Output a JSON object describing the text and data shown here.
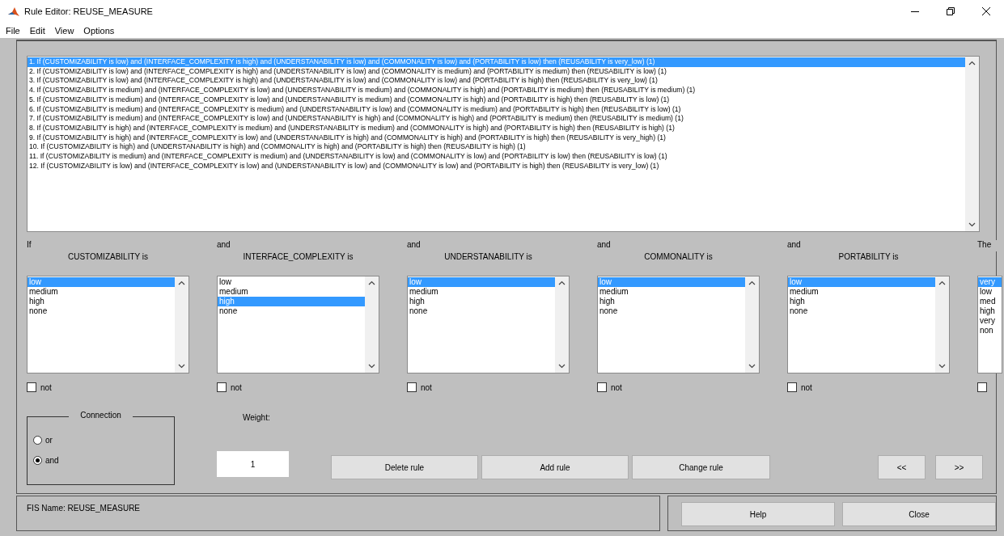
{
  "window": {
    "title": "Rule Editor: REUSE_MEASURE"
  },
  "menu": [
    "File",
    "Edit",
    "View",
    "Options"
  ],
  "rules": [
    {
      "text": "1. If (CUSTOMIZABILITY is low) and (INTERFACE_COMPLEXITY is high) and (UNDERSTANABILITY is low) and (COMMONALITY is low) and (PORTABILITY is low) then (REUSABILITY is very_low) (1)",
      "selected": true
    },
    {
      "text": "2. If (CUSTOMIZABILITY is low) and (INTERFACE_COMPLEXITY is high) and (UNDERSTANABILITY is low) and (COMMONALITY is medium) and (PORTABILITY is medium) then (REUSABILITY is low) (1)",
      "selected": false
    },
    {
      "text": "3. If (CUSTOMIZABILITY is low) and (INTERFACE_COMPLEXITY is high) and (UNDERSTANABILITY is low) and (COMMONALITY is low) and (PORTABILITY is high) then (REUSABILITY is very_low) (1)",
      "selected": false
    },
    {
      "text": "4. If (CUSTOMIZABILITY is medium) and (INTERFACE_COMPLEXITY is low) and (UNDERSTANABILITY is medium) and (COMMONALITY is high) and (PORTABILITY is medium) then (REUSABILITY is medium) (1)",
      "selected": false
    },
    {
      "text": "5. If (CUSTOMIZABILITY is medium) and (INTERFACE_COMPLEXITY is low) and (UNDERSTANABILITY is medium) and (COMMONALITY is high) and (PORTABILITY is high) then (REUSABILITY is low) (1)",
      "selected": false
    },
    {
      "text": "6. If (CUSTOMIZABILITY is medium) and (INTERFACE_COMPLEXITY is medium) and (UNDERSTANABILITY is low) and (COMMONALITY is medium) and (PORTABILITY is high) then (REUSABILITY is low) (1)",
      "selected": false
    },
    {
      "text": "7. If (CUSTOMIZABILITY is medium) and (INTERFACE_COMPLEXITY is low) and (UNDERSTANABILITY is high) and (COMMONALITY is high) and (PORTABILITY is medium) then (REUSABILITY is medium) (1)",
      "selected": false
    },
    {
      "text": "8. If (CUSTOMIZABILITY is high) and (INTERFACE_COMPLEXITY is medium) and (UNDERSTANABILITY is medium) and (COMMONALITY is high) and (PORTABILITY is high) then (REUSABILITY is high) (1)",
      "selected": false
    },
    {
      "text": "9. If (CUSTOMIZABILITY is high) and (INTERFACE_COMPLEXITY is low) and (UNDERSTANABILITY is high) and (COMMONALITY is high) and (PORTABILITY is high) then (REUSABILITY is very_high) (1)",
      "selected": false
    },
    {
      "text": "10. If (CUSTOMIZABILITY is high) and (UNDERSTANABILITY is high) and (COMMONALITY is high) and (PORTABILITY is high) then (REUSABILITY is high) (1)",
      "selected": false
    },
    {
      "text": "11. If (CUSTOMIZABILITY is medium) and (INTERFACE_COMPLEXITY is medium) and (UNDERSTANABILITY is low) and (COMMONALITY is low) and (PORTABILITY is low) then (REUSABILITY is low) (1)",
      "selected": false
    },
    {
      "text": "12. If (CUSTOMIZABILITY is low) and (INTERFACE_COMPLEXITY is low) and (UNDERSTANABILITY is low) and (COMMONALITY is low) and (PORTABILITY is high) then (REUSABILITY is very_low) (1)",
      "selected": false
    }
  ],
  "antecedents": [
    {
      "connector": "If",
      "variable": "CUSTOMIZABILITY is",
      "negated": false,
      "not_label": "not",
      "options": [
        {
          "label": "low",
          "selected": true
        },
        {
          "label": "medium",
          "selected": false
        },
        {
          "label": "high",
          "selected": false
        },
        {
          "label": "none",
          "selected": false
        }
      ]
    },
    {
      "connector": "and",
      "variable": "INTERFACE_COMPLEXITY is",
      "negated": false,
      "not_label": "not",
      "options": [
        {
          "label": "low",
          "selected": false
        },
        {
          "label": "medium",
          "selected": false
        },
        {
          "label": "high",
          "selected": true
        },
        {
          "label": "none",
          "selected": false
        }
      ]
    },
    {
      "connector": "and",
      "variable": "UNDERSTANABILITY is",
      "negated": false,
      "not_label": "not",
      "options": [
        {
          "label": "low",
          "selected": true
        },
        {
          "label": "medium",
          "selected": false
        },
        {
          "label": "high",
          "selected": false
        },
        {
          "label": "none",
          "selected": false
        }
      ]
    },
    {
      "connector": "and",
      "variable": "COMMONALITY is",
      "negated": false,
      "not_label": "not",
      "options": [
        {
          "label": "low",
          "selected": true
        },
        {
          "label": "medium",
          "selected": false
        },
        {
          "label": "high",
          "selected": false
        },
        {
          "label": "none",
          "selected": false
        }
      ]
    },
    {
      "connector": "and",
      "variable": "PORTABILITY is",
      "negated": false,
      "not_label": "not",
      "options": [
        {
          "label": "low",
          "selected": true
        },
        {
          "label": "medium",
          "selected": false
        },
        {
          "label": "high",
          "selected": false
        },
        {
          "label": "none",
          "selected": false
        }
      ]
    }
  ],
  "consequent": {
    "connector": "The",
    "negated": false,
    "options": [
      {
        "label": "very",
        "selected": true
      },
      {
        "label": "low",
        "selected": false
      },
      {
        "label": "med",
        "selected": false
      },
      {
        "label": "high",
        "selected": false
      },
      {
        "label": "very",
        "selected": false
      },
      {
        "label": "non",
        "selected": false
      }
    ]
  },
  "connection": {
    "title": "Connection",
    "options": [
      {
        "label": "or",
        "selected": false
      },
      {
        "label": "and",
        "selected": true
      }
    ]
  },
  "weight": {
    "label": "Weight:",
    "value": "1"
  },
  "buttons": [
    "Delete rule",
    "Add rule",
    "Change rule"
  ],
  "nav_buttons": [
    "<<",
    ">>"
  ],
  "status": "FIS Name: REUSE_MEASURE",
  "footer_buttons": [
    "Help",
    "Close"
  ]
}
